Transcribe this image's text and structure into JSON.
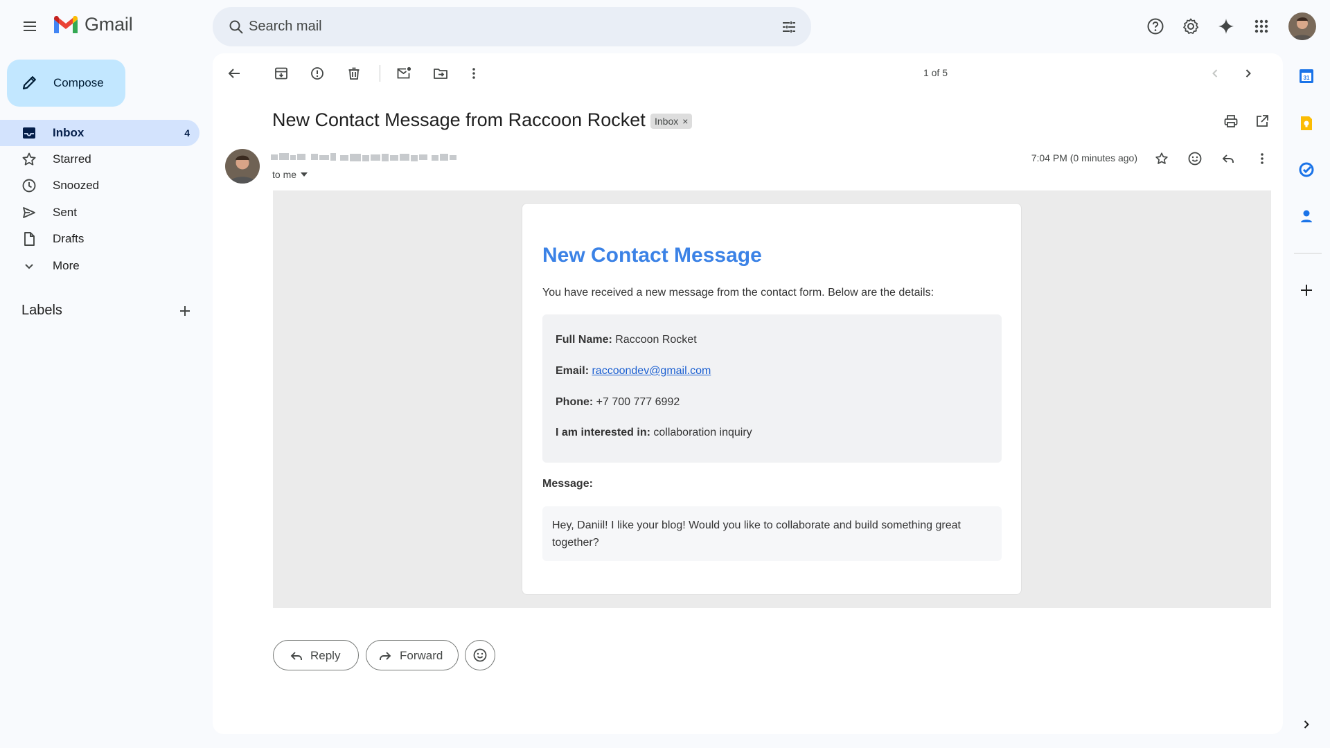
{
  "header": {
    "app_name": "Gmail",
    "search_placeholder": "Search mail"
  },
  "sidebar": {
    "compose_label": "Compose",
    "items": [
      {
        "label": "Inbox",
        "count": "4",
        "icon": "inbox-icon",
        "active": true
      },
      {
        "label": "Starred",
        "count": "",
        "icon": "star-icon"
      },
      {
        "label": "Snoozed",
        "count": "",
        "icon": "clock-icon"
      },
      {
        "label": "Sent",
        "count": "",
        "icon": "send-icon"
      },
      {
        "label": "Drafts",
        "count": "",
        "icon": "draft-icon"
      },
      {
        "label": "More",
        "count": "",
        "icon": "chevron-down-icon"
      }
    ],
    "labels_title": "Labels"
  },
  "toolbar": {
    "pager": "1 of 5"
  },
  "email": {
    "subject": "New Contact Message from Raccoon Rocket",
    "label_chip": "Inbox",
    "label_chip_close": "×",
    "recipient": "to me",
    "timestamp": "7:04 PM (0 minutes ago)",
    "body": {
      "title": "New Contact Message",
      "intro": "You have received a new message from the contact form. Below are the details:",
      "fields": [
        {
          "label": "Full Name:",
          "value": "Raccoon Rocket"
        },
        {
          "label": "Email:",
          "value": "raccoondev@gmail.com"
        },
        {
          "label": "Phone:",
          "value": "+7 700 777 6992"
        },
        {
          "label": "I am interested in:",
          "value": "collaboration inquiry"
        }
      ],
      "message_label": "Message:",
      "message": "Hey, Daniil! I like your blog! Would you like to collaborate and build something great together?"
    }
  },
  "actions": {
    "reply": "Reply",
    "forward": "Forward"
  },
  "colors": {
    "accent": "#0b57d0",
    "compose_bg": "#c2e7ff",
    "active_nav": "#d3e3fd",
    "card_title": "#3b82e6"
  }
}
